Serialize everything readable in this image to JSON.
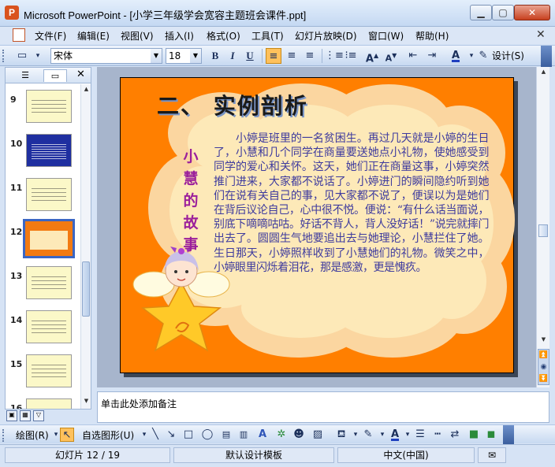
{
  "window": {
    "title": "Microsoft PowerPoint - [小学三年级学会宽容主题班会课件.ppt]",
    "app_icon": "powerpoint-icon"
  },
  "menu": {
    "items": [
      "文件(F)",
      "编辑(E)",
      "视图(V)",
      "插入(I)",
      "格式(O)",
      "工具(T)",
      "幻灯片放映(D)",
      "窗口(W)",
      "帮助(H)"
    ]
  },
  "format_toolbar": {
    "font_name": "宋体",
    "font_size": "18",
    "bold": "B",
    "italic": "I",
    "underline": "U",
    "design_label": "设计(S)"
  },
  "slide_panel": {
    "thumbnails": [
      {
        "number": "9",
        "style": "yellow"
      },
      {
        "number": "10",
        "style": "blue"
      },
      {
        "number": "11",
        "style": "yellow"
      },
      {
        "number": "12",
        "style": "selected"
      },
      {
        "number": "13",
        "style": "yellow"
      },
      {
        "number": "14",
        "style": "yellow"
      },
      {
        "number": "15",
        "style": "yellow"
      },
      {
        "number": "16",
        "style": "yellow"
      }
    ]
  },
  "slide": {
    "title": "二、 实例剖析",
    "story_label": "小慧的故事",
    "body": "小婷是班里的一名贫困生。再过几天就是小婷的生日了，小慧和几个同学在商量要送她点小礼物，使她感受到同学的爱心和关怀。这天，她们正在商量这事，小婷突然推门进来，大家都不说话了。小婷进门的瞬间隐约听到她们在说有关自己的事，见大家都不说了，便误以为是她们在背后议论自己，心中很不悦。便说：“有什么话当面说，别底下嘀嘀咕咕。好话不背人，背人没好话！”说完就摔门出去了。圆圆生气地要追出去与她理论，小慧拦住了她。生日那天，小婷照样收到了小慧她们的礼物。微笑之中，小婷眼里闪烁着泪花，那是感激，更是愧疚。",
    "colors": {
      "background": "#ff7f00",
      "cloud": "#fde9b8",
      "cloud_outer": "#fbd6a0",
      "title_text": "#1a1a1a",
      "label_text": "#9b1f9b",
      "body_text": "#3e3b9e"
    }
  },
  "notes": {
    "placeholder": "单击此处添加备注"
  },
  "draw_toolbar": {
    "draw_label": "绘图(R)",
    "autoshape_label": "自选图形(U)"
  },
  "status": {
    "slide_info": "幻灯片 12 / 19",
    "template": "默认设计模板",
    "language": "中文(中国)"
  }
}
